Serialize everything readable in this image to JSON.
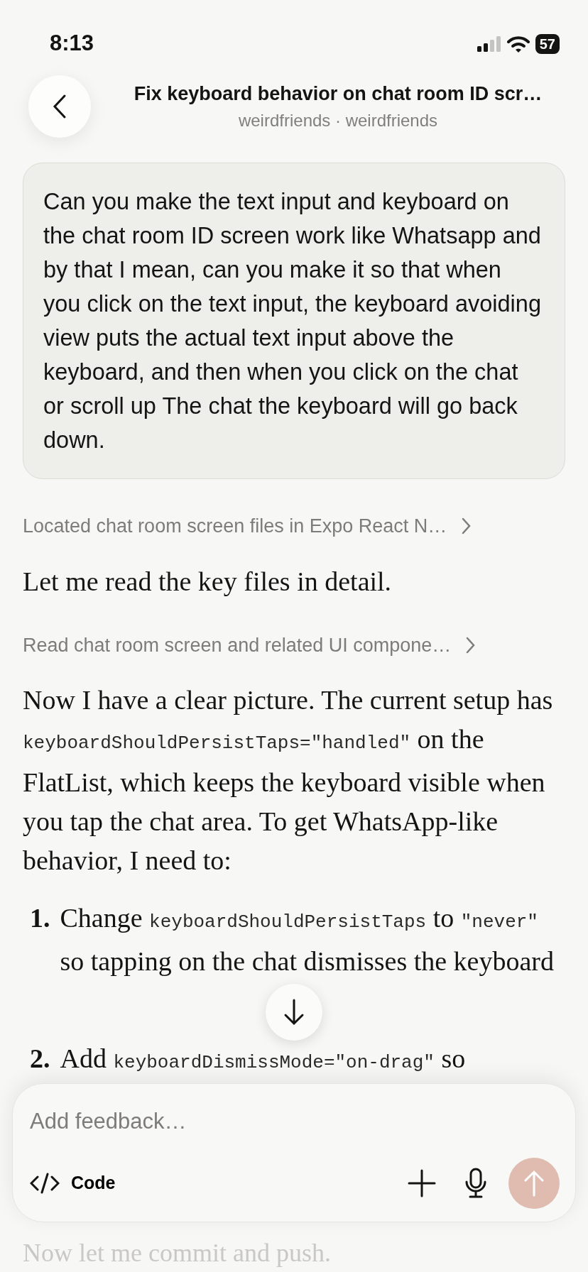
{
  "status_bar": {
    "time": "8:13",
    "battery": "57"
  },
  "header": {
    "title": "Fix keyboard behavior on chat room ID scr…",
    "subtitle": "weirdfriends · weirdfriends"
  },
  "messages": [
    {
      "kind": "user",
      "text": "Can you make the text input and keyboard on the chat room ID screen work like Whatsapp and by that I mean, can you make it so that when you click on the text input, the keyboard avoiding view puts the actual text input above the keyboard, and then when you click on the chat or scroll up The chat the keyboard will go back down."
    },
    {
      "kind": "step",
      "text": "Located chat room screen files in Expo React N…"
    },
    {
      "kind": "reply",
      "segments": [
        {
          "kind": "text",
          "text": "Let me read the key files in detail."
        }
      ]
    },
    {
      "kind": "step",
      "text": "Read chat room screen and related UI compone…"
    },
    {
      "kind": "reply",
      "segments": [
        {
          "kind": "text",
          "text": "Now I have a clear picture. The current setup has "
        },
        {
          "kind": "code",
          "text": "keyboardShouldPersistTaps=\"handled\""
        },
        {
          "kind": "text",
          "text": " on the FlatList, which keeps the keyboard visible when you tap the chat area. To get WhatsApp-like behavior, I need to:"
        }
      ]
    },
    {
      "kind": "list",
      "items": [
        {
          "number": "1.",
          "segments": [
            {
              "kind": "text",
              "text": "Change "
            },
            {
              "kind": "code",
              "text": "keyboardShouldPersistTaps"
            },
            {
              "kind": "text",
              "text": " to "
            },
            {
              "kind": "code",
              "text": "\"never\""
            },
            {
              "kind": "text",
              "text": " so tapping on the chat dismisses the keyboard"
            }
          ]
        },
        {
          "number": "2.",
          "segments": [
            {
              "kind": "text",
              "text": "Add "
            },
            {
              "kind": "code",
              "text": "keyboardDismissMode=\"on-drag\""
            },
            {
              "kind": "text",
              "text": " so"
            }
          ]
        }
      ]
    },
    {
      "kind": "faded",
      "text": "Now let me commit and push."
    }
  ],
  "composer": {
    "placeholder": "Add feedback…",
    "mode": "Code",
    "send_enabled": false
  }
}
